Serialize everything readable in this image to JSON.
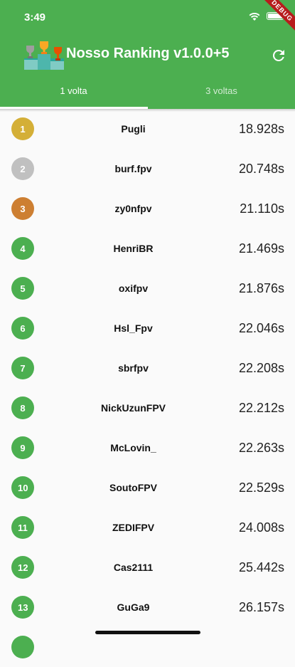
{
  "status": {
    "time": "3:49"
  },
  "debug_banner": "DEBUG",
  "appbar": {
    "title": "Nosso Ranking v1.0.0+5"
  },
  "tabs": [
    {
      "label": "1 volta",
      "selected": true
    },
    {
      "label": "3 voltas",
      "selected": false
    }
  ],
  "colors": {
    "primary": "#4caf50",
    "gold": "#d4af37",
    "silver": "#c0c0c0",
    "bronze": "#cd7f32",
    "default_badge": "#4caf50"
  },
  "ranking": [
    {
      "pos": "1",
      "name": "Pugli",
      "time": "18.928s",
      "badge": "gold"
    },
    {
      "pos": "2",
      "name": "burf.fpv",
      "time": "20.748s",
      "badge": "silver"
    },
    {
      "pos": "3",
      "name": "zy0nfpv",
      "time": "21.110s",
      "badge": "bronze"
    },
    {
      "pos": "4",
      "name": "HenriBR",
      "time": "21.469s",
      "badge": "default"
    },
    {
      "pos": "5",
      "name": "oxifpv",
      "time": "21.876s",
      "badge": "default"
    },
    {
      "pos": "6",
      "name": "Hsl_Fpv",
      "time": "22.046s",
      "badge": "default"
    },
    {
      "pos": "7",
      "name": "sbrfpv",
      "time": "22.208s",
      "badge": "default"
    },
    {
      "pos": "8",
      "name": "NickUzunFPV",
      "time": "22.212s",
      "badge": "default"
    },
    {
      "pos": "9",
      "name": "McLovin_",
      "time": "22.263s",
      "badge": "default"
    },
    {
      "pos": "10",
      "name": "SoutoFPV",
      "time": "22.529s",
      "badge": "default"
    },
    {
      "pos": "11",
      "name": "ZEDIFPV",
      "time": "24.008s",
      "badge": "default"
    },
    {
      "pos": "12",
      "name": "Cas2111",
      "time": "25.442s",
      "badge": "default"
    },
    {
      "pos": "13",
      "name": "GuGa9",
      "time": "26.157s",
      "badge": "default"
    }
  ]
}
